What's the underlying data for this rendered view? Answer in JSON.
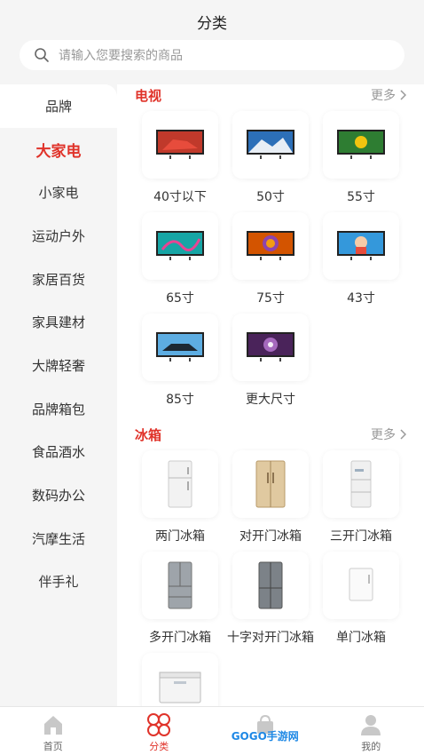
{
  "header": {
    "title": "分类",
    "search_placeholder": "请输入您要搜索的商品"
  },
  "sidebar": {
    "items": [
      "品牌",
      "大家电",
      "小家电",
      "运动户外",
      "家居百货",
      "家具建材",
      "大牌轻奢",
      "品牌箱包",
      "食品酒水",
      "数码办公",
      "汽摩生活",
      "伴手礼"
    ]
  },
  "sections": [
    {
      "title": "电视",
      "more": "更多",
      "items": [
        "40寸以下",
        "50寸",
        "55寸",
        "65寸",
        "75寸",
        "43寸",
        "85寸",
        "更大尺寸"
      ]
    },
    {
      "title": "冰箱",
      "more": "更多",
      "items": [
        "两门冰箱",
        "对开门冰箱",
        "三开门冰箱",
        "多开门冰箱",
        "十字对开门冰箱",
        "单门冰箱",
        ""
      ]
    }
  ],
  "tabbar": {
    "items": [
      "首页",
      "分类",
      "",
      "我的"
    ],
    "watermark": "GOGO手游网"
  },
  "colors": {
    "accent": "#e0332a",
    "muted": "#999999"
  }
}
